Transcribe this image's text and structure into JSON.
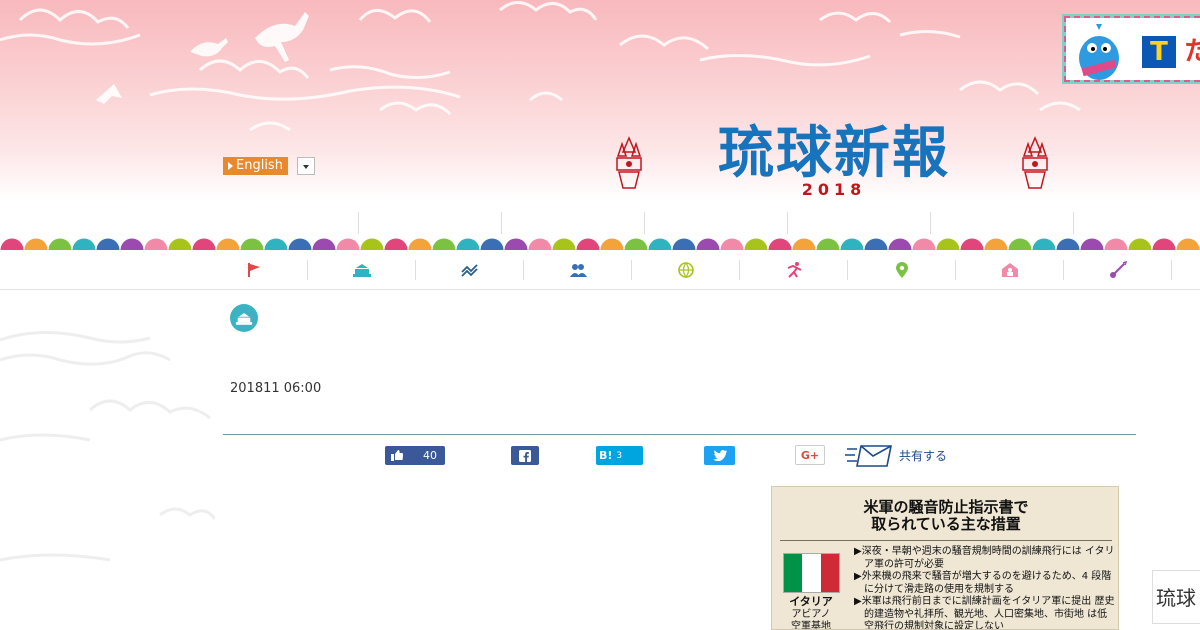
{
  "header": {
    "logo_text": "琉球新報",
    "year": "2018",
    "language": {
      "label": "English"
    },
    "ad": {
      "badge": "T",
      "text": "た"
    },
    "top_nav": [
      "",
      "",
      "",
      "",
      "",
      ""
    ]
  },
  "categories": [
    {
      "icon": "flag-icon",
      "color": "#e04848"
    },
    {
      "icon": "government-building-icon",
      "color": "#2fb3c0"
    },
    {
      "icon": "trend-chart-icon",
      "color": "#2a5f8c"
    },
    {
      "icon": "people-icon",
      "color": "#3a6fb5"
    },
    {
      "icon": "globe-icon",
      "color": "#a8c31a"
    },
    {
      "icon": "runner-icon",
      "color": "#e0457b"
    },
    {
      "icon": "location-pin-icon",
      "color": "#7cc242"
    },
    {
      "icon": "house-icon",
      "color": "#f08aa8"
    },
    {
      "icon": "sanshin-icon",
      "color": "#9b4bb0"
    }
  ],
  "article": {
    "category_icon": "government-building-icon",
    "date": "201811 06:00"
  },
  "share": {
    "like_count": "40",
    "hatena_label": "B!",
    "hatena_count": "3",
    "gplus_label": "G+",
    "share_label": "共有する"
  },
  "figure": {
    "title_line1": "米軍の騒音防止指示書で",
    "title_line2": "取られている主な措置",
    "country": "イタリア",
    "base_line1": "アビアノ",
    "base_line2": "空軍基地",
    "bullets": [
      "▶深夜・早朝や週末の騒音規制時間の訓練飛行には イタリア軍の許可が必要",
      "▶外来機の飛来で騒音が増大するのを避けるため、4 段階に分けて滑走路の使用を規制する",
      "▶米軍は飛行前日までに訓練計画をイタリア軍に提出 歴史的建造物や礼拝所、観光地、人口密集地、市街地 は低空飛行の規制対象に設定しない"
    ]
  },
  "corner_badge": "琉球"
}
